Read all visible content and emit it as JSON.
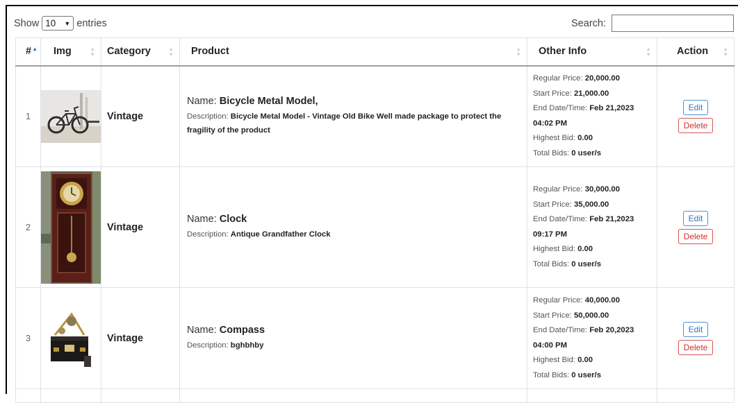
{
  "controls": {
    "show_label": "Show",
    "entries_value": "10",
    "entries_label": "entries",
    "search_label": "Search:",
    "search_value": ""
  },
  "table": {
    "headers": [
      "#",
      "Img",
      "Category",
      "Product",
      "Other Info",
      "Action"
    ],
    "sorted_column": "#",
    "sort_direction": "ascending",
    "labels": {
      "name": "Name:",
      "description": "Description:",
      "regular_price": "Regular Price:",
      "start_price": "Start Price:",
      "end_datetime": "End Date/Time:",
      "highest_bid": "Highest Bid:",
      "total_bids": "Total Bids:"
    },
    "rows": [
      {
        "index": "1",
        "image_icon": "bicycle-image",
        "category": "Vintage",
        "name": "Bicycle Metal Model,",
        "description": "Bicycle Metal Model - Vintage Old Bike Well made package to protect the fragility of the product",
        "regular_price": "20,000.00",
        "start_price": "21,000.00",
        "end_date": "Feb 21,2023",
        "end_time": "04:02 PM",
        "highest_bid": "0.00",
        "total_bids": "0 user/s",
        "edit_label": "Edit",
        "delete_label": "Delete"
      },
      {
        "index": "2",
        "image_icon": "grandfather-clock-image",
        "category": "Vintage",
        "name": "Clock",
        "description": "Antique Grandfather Clock",
        "regular_price": "30,000.00",
        "start_price": "35,000.00",
        "end_date": "Feb 21,2023",
        "end_time": "09:17 PM",
        "highest_bid": "0.00",
        "total_bids": "0 user/s",
        "edit_label": "Edit",
        "delete_label": "Delete"
      },
      {
        "index": "3",
        "image_icon": "compass-image",
        "category": "Vintage",
        "name": "Compass",
        "description": "bghbhby",
        "regular_price": "40,000.00",
        "start_price": "50,000.00",
        "end_date": "Feb 20,2023",
        "end_time": "04:00 PM",
        "highest_bid": "0.00",
        "total_bids": "0 user/s",
        "edit_label": "Edit",
        "delete_label": "Delete"
      }
    ]
  },
  "colors": {
    "edit_button": "#2f74c0",
    "delete_button": "#c9302c",
    "border": "#dee2e6",
    "sort_active": "#3d6fb3"
  }
}
